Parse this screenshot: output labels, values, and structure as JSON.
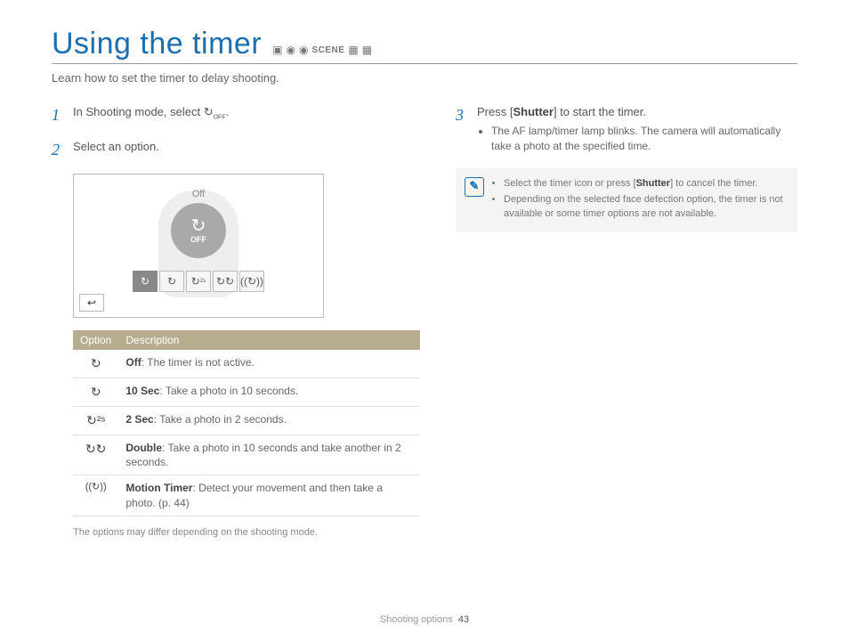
{
  "title": "Using the timer",
  "intro": "Learn how to set the timer to delay shooting.",
  "mode_icons": [
    "camera-auto-icon",
    "camera-icon",
    "camera2-icon",
    "scene-icon",
    "video1-icon",
    "video2-icon"
  ],
  "scene_label": "SCENE",
  "steps": {
    "s1": {
      "num": "1",
      "text_a": "In Shooting mode, select ",
      "text_b": "."
    },
    "s2": {
      "num": "2",
      "text": "Select an option."
    },
    "s3": {
      "num": "3",
      "text_a": "Press [",
      "shutter": "Shutter",
      "text_b": "] to start the timer.",
      "bullet": "The AF lamp/timer lamp blinks. The camera will automatically take a photo at the specified time."
    }
  },
  "screen": {
    "off_label": "Off",
    "big_off": "OFF",
    "strip": [
      "off",
      "10s",
      "2s",
      "double",
      "motion"
    ],
    "back": "↩"
  },
  "table": {
    "headers": {
      "option": "Option",
      "description": "Description"
    },
    "rows": [
      {
        "icon": "↻",
        "label": "Off",
        "desc": ": The timer is not active."
      },
      {
        "icon": "↻",
        "label": "10 Sec",
        "desc": ": Take a photo in 10 seconds."
      },
      {
        "icon": "↻²ˢ",
        "label": "2 Sec",
        "desc": ": Take a photo in 2 seconds."
      },
      {
        "icon": "↻↻",
        "label": "Double",
        "desc": ": Take a photo in 10 seconds and take another in 2 seconds."
      },
      {
        "icon": "((↻))",
        "label": "Motion Timer",
        "desc": ": Detect your movement and then take a photo. (p. 44)"
      }
    ]
  },
  "footnote": "The options may differ depending on the shooting mode.",
  "note": {
    "items": [
      {
        "a": "Select the timer icon or press [",
        "shutter": "Shutter",
        "b": "] to cancel the timer."
      },
      {
        "a": "Depending on the selected face defection option, the timer is not available or some timer options are not available.",
        "shutter": "",
        "b": ""
      }
    ]
  },
  "footer": {
    "section": "Shooting options",
    "page": "43"
  }
}
